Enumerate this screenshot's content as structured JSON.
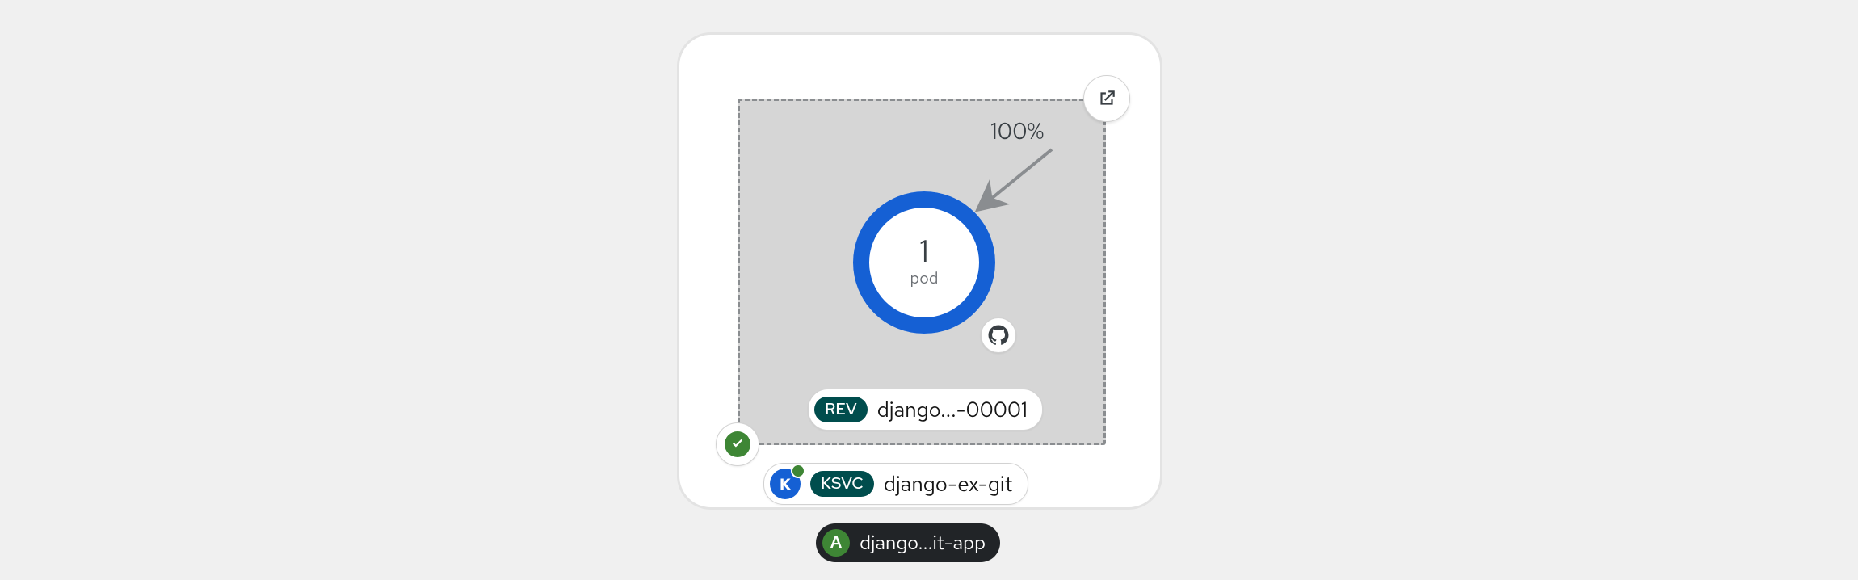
{
  "service": {
    "ksvc_kind_tag": "KSVC",
    "ksvc_name": "django-ex-git",
    "traffic_percent": "100%",
    "status": "ready",
    "knative_letter": "K"
  },
  "revision": {
    "kind_tag": "REV",
    "display_name": "django...-00001",
    "pod_count": "1",
    "pod_label": "pod",
    "source_type": "git"
  },
  "application": {
    "badge_letter": "A",
    "display_name": "django...it-app"
  }
}
